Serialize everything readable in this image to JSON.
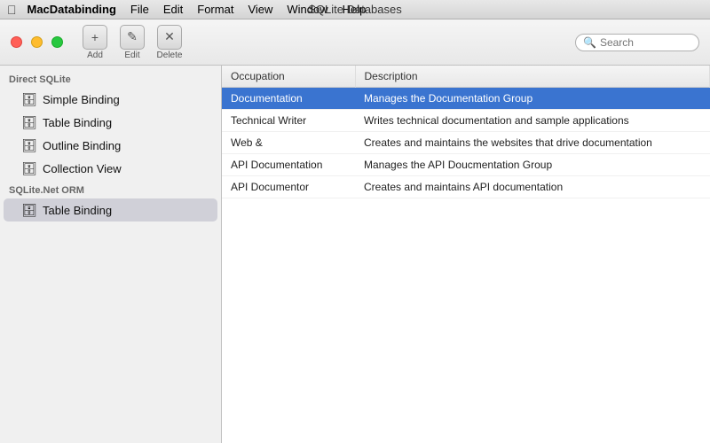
{
  "titlebar": {
    "apple": "",
    "window_title": "SQLite Databases",
    "menu_items": [
      "MacDatabinding",
      "File",
      "Edit",
      "Format",
      "View",
      "Window",
      "Help"
    ]
  },
  "toolbar": {
    "traffic_lights": [
      "red",
      "yellow",
      "green"
    ],
    "buttons": [
      {
        "label": "Add",
        "icon": "+"
      },
      {
        "label": "Edit",
        "icon": "✎"
      },
      {
        "label": "Delete",
        "icon": "✕"
      }
    ],
    "search_placeholder": "Search"
  },
  "sidebar": {
    "sections": [
      {
        "header": "Direct SQLite",
        "items": [
          {
            "label": "Simple Binding",
            "icon": "🗄",
            "active": false
          },
          {
            "label": "Table Binding",
            "icon": "🗄",
            "active": false
          },
          {
            "label": "Outline Binding",
            "icon": "🗄",
            "active": false
          },
          {
            "label": "Collection View",
            "icon": "🗄",
            "active": false
          }
        ]
      },
      {
        "header": "SQLite.Net ORM",
        "items": [
          {
            "label": "Table Binding",
            "icon": "🗄",
            "active": true
          }
        ]
      }
    ]
  },
  "table": {
    "columns": [
      "Occupation",
      "Description"
    ],
    "rows": [
      {
        "occupation": "Documentation",
        "description": "Manages the Documentation Group",
        "selected": true
      },
      {
        "occupation": "Technical Writer",
        "description": "Writes technical documentation and sample applications",
        "selected": false
      },
      {
        "occupation": "Web &",
        "description": "Creates and maintains the websites that drive documentation",
        "selected": false
      },
      {
        "occupation": "API Documentation",
        "description": "Manages the API Doucmentation Group",
        "selected": false
      },
      {
        "occupation": "API Documentor",
        "description": "Creates and maintains API documentation",
        "selected": false
      }
    ]
  }
}
